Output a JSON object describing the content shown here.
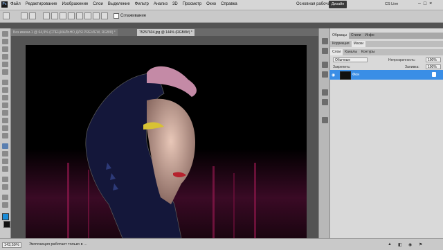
{
  "app": {
    "logo": "Ps"
  },
  "menu": [
    "Файл",
    "Редактирование",
    "Изображение",
    "Слои",
    "Выделение",
    "Фильтр",
    "Анализ",
    "3D",
    "Просмотр",
    "Окно",
    "Справка"
  ],
  "zoom_menu": "144%",
  "workspace": {
    "name": "Основная рабочая среда",
    "button": "Дизайн"
  },
  "cslive": "CS Live",
  "window_buttons": [
    "–",
    "□",
    "×"
  ],
  "options": {
    "antialias": "Сглаживание"
  },
  "tabs": [
    {
      "label": "Без имени-1 @ 64,9% (СПЕЦИАЛЬНО ДЛЯ PREVIEW, RGB/8) *"
    },
    {
      "label": "75257604.jpg @ 144% (RGB/8#) *"
    }
  ],
  "status": {
    "zoom": "143,59%",
    "message": "Экспозиция работает только в ..."
  },
  "panels": {
    "top_tabs": [
      "Образцы",
      "Стили",
      "Инфо"
    ],
    "mid_tabs": [
      "Коррекция",
      "Маски"
    ],
    "layer_tabs": [
      "Слои",
      "Каналы",
      "Контуры"
    ],
    "blend_mode": "Обычные",
    "opacity_label": "Непрозрачность:",
    "opacity_value": "100%",
    "fill_label": "Заливка:",
    "fill_value": "100%",
    "lock_label": "Закрепить:",
    "layer_name": "Фон"
  },
  "colors": {
    "accent": "#3a8ee6",
    "foreground": "#1a8cd8",
    "background": "#111111"
  }
}
